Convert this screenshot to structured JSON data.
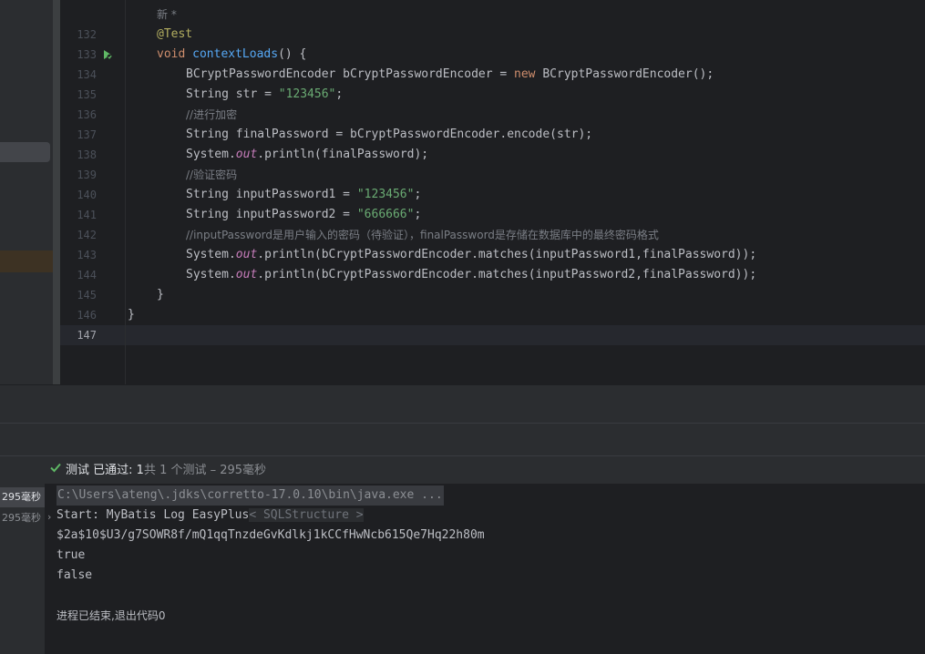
{
  "editor": {
    "author_hint": "新 *",
    "line_numbers": [
      "132",
      "133",
      "134",
      "135",
      "136",
      "137",
      "138",
      "139",
      "140",
      "141",
      "142",
      "143",
      "144",
      "145",
      "146",
      "147"
    ],
    "lines": {
      "l132_annotation": "@Test",
      "l133_kw": "void",
      "l133_method": "contextLoads",
      "l133_rest": "() {",
      "l134_type": "BCryptPasswordEncoder bCryptPasswordEncoder = ",
      "l134_new": "new",
      "l134_rest": " BCryptPasswordEncoder();",
      "l135_a": "String str = ",
      "l135_str": "\"123456\"",
      "l135_b": ";",
      "l136_comment": "//进行加密",
      "l137": "String finalPassword = bCryptPasswordEncoder.encode(str);",
      "l138_a": "System.",
      "l138_field": "out",
      "l138_b": ".println(finalPassword);",
      "l139_comment": "//验证密码",
      "l140_a": "String inputPassword1 = ",
      "l140_str": "\"123456\"",
      "l140_b": ";",
      "l141_a": "String inputPassword2 = ",
      "l141_str": "\"666666\"",
      "l141_b": ";",
      "l142_comment": "//inputPassword是用户输入的密码（待验证），finalPassword是存储在数据库中的最终密码格式",
      "l143_a": "System.",
      "l143_field": "out",
      "l143_b": ".println(bCryptPasswordEncoder.matches(inputPassword1,finalPassword));",
      "l144_a": "System.",
      "l144_field": "out",
      "l144_b": ".println(bCryptPasswordEncoder.matches(inputPassword2,finalPassword));",
      "l145": "}",
      "l146": "}"
    }
  },
  "test_status": {
    "label": "测试 已通过:",
    "count": "1",
    "suffix": "共 1 个测试 – 295毫秒"
  },
  "test_tree": [
    {
      "label": "295毫秒"
    },
    {
      "label": "295毫秒"
    }
  ],
  "console": {
    "command": "C:\\Users\\ateng\\.jdks\\corretto-17.0.10\\bin\\java.exe ...",
    "start_line": "Start: MyBatis Log EasyPlus",
    "sql_fold": "< SQLStructure >",
    "hash": "$2a$10$U3/g7SOWR8f/mQ1qqTnzdeGvKdlkj1kCCfHwNcb615Qe7Hq22h80m",
    "result1": "true",
    "result2": "false",
    "exit": "进程已结束,退出代码0"
  },
  "colors": {
    "keyword": "#cf8e6d",
    "annotation": "#b3ae60",
    "method": "#56a8f5",
    "string": "#6aab73",
    "comment": "#7a7e85",
    "field": "#c77dbb",
    "passed": "#5fb865"
  }
}
